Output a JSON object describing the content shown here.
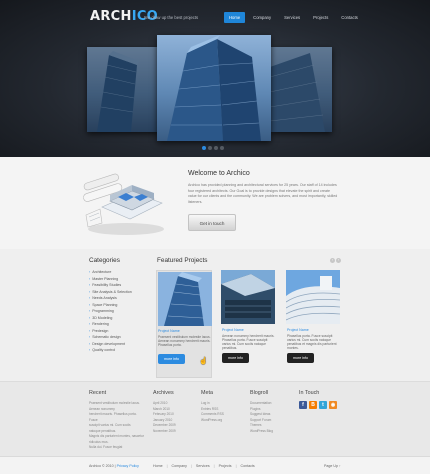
{
  "logo": {
    "part1": "ARCH",
    "part2": "ICO"
  },
  "header": {
    "tagline": "We draw up the best projects"
  },
  "nav": [
    {
      "label": "Home",
      "active": true
    },
    {
      "label": "Company",
      "active": false
    },
    {
      "label": "Services",
      "active": false
    },
    {
      "label": "Projects",
      "active": false
    },
    {
      "label": "Contacts",
      "active": false
    }
  ],
  "slider": {
    "dot_count": 4,
    "active_dot": 0
  },
  "welcome": {
    "title": "Welcome to Archico",
    "text": "Archico has provided planning and architectural services for 25 years. Our staff of 14 includes four registered architects. Our Goal is to provide designs that elevate the spirit and create value for our clients and the community. We are problem solvers, and most importantly, skilled listeners.",
    "button": "Get in touch"
  },
  "categories": {
    "title": "Categories",
    "items": [
      "Architecture",
      "Master Planning",
      "Feasibility Studies",
      "Site Analysis & Selection",
      "Needs Analysis",
      "Space Planning",
      "Programming",
      "3D Modeling",
      "Rendering",
      "Predesign",
      "Schematic design",
      "Design development",
      "Quality control"
    ]
  },
  "featured": {
    "title": "Featured Projects",
    "arrow_prev": "‹",
    "arrow_next": "›",
    "projects": [
      {
        "title": "Project Name",
        "desc": "Praesent vestibulum molestie lacus. Aenean nonummy hendrerit mauris. Phasellus porta.",
        "button": "more info"
      },
      {
        "title": "Project Name",
        "desc": "Aenean nonummy hendrerit mauris. Phasellus porta. Fusce suscipit varius mi. Cum sociis natoque penatibus.",
        "button": "more info"
      },
      {
        "title": "Project Name",
        "desc": "Phasellus porta. Fusce suscipit varius mi. Cum sociis natoque penatibus et magnis dis parturient montes.",
        "button": "more info"
      }
    ]
  },
  "footer": {
    "recent": {
      "title": "Recent",
      "items": [
        "Praesent vestibulum molestie lacus.",
        "Aenean nonummy",
        "hendrerit mauris. Phasellus porta.",
        "Fusce",
        "suscipit varius mi. Cum sociis",
        "natoque penatibus.",
        "Magnis dis parturient montes, nascetur",
        "ridiculus mus.",
        "Nulla dui. Fusce feugiat"
      ]
    },
    "archives": {
      "title": "Archives",
      "items": [
        "April 2010",
        "March 2010",
        "February 2010",
        "January 2010",
        "December 2009",
        "November 2009"
      ]
    },
    "meta": {
      "title": "Meta",
      "items": [
        "Log in",
        "Entries RSS",
        "Comments RSS",
        "WordPress.org"
      ]
    },
    "blogroll": {
      "title": "Blogroll",
      "items": [
        "Documentation",
        "Plugins",
        "Suggest Ideas",
        "Support Forum",
        "Themes",
        "WordPress Blog"
      ]
    },
    "intouch": {
      "title": "In Touch",
      "icons": [
        {
          "name": "facebook-icon",
          "glyph": "f",
          "color": "#3b5998"
        },
        {
          "name": "blogger-icon",
          "glyph": "B",
          "color": "#f57d00"
        },
        {
          "name": "twitter-icon",
          "glyph": "t",
          "color": "#33a5d8"
        },
        {
          "name": "rss-icon",
          "glyph": "◉",
          "color": "#f08a24"
        }
      ]
    }
  },
  "bottom": {
    "copyright": "Archico © 2010",
    "privacy": "Privacy Policy",
    "links": [
      "Home",
      "Company",
      "Services",
      "Projects",
      "Contacts"
    ],
    "page_up": "Page Up ↑"
  },
  "colors": {
    "accent": "#2c8be0",
    "nav_active": "#1f86d9",
    "header_bg": "#232830"
  }
}
